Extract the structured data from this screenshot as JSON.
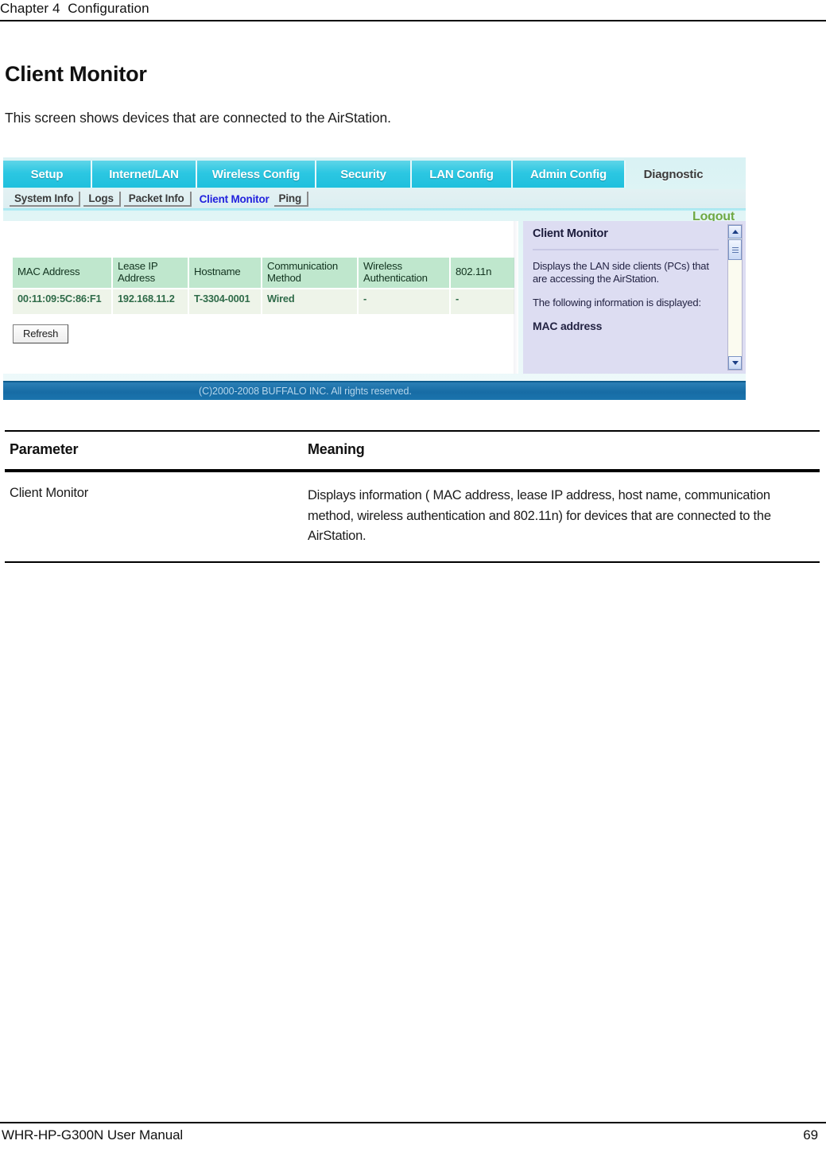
{
  "page": {
    "running_head": "Chapter 4  Configuration",
    "heading": "Client Monitor",
    "intro": "This screen shows devices that are connected to the AirStation.",
    "footer_left": "WHR-HP-G300N User Manual",
    "footer_page": "69"
  },
  "screenshot": {
    "nav_tabs": [
      {
        "label": "Setup",
        "active": false
      },
      {
        "label": "Internet/LAN",
        "active": false
      },
      {
        "label": "Wireless Config",
        "active": false
      },
      {
        "label": "Security",
        "active": false
      },
      {
        "label": "LAN Config",
        "active": false
      },
      {
        "label": "Admin Config",
        "active": false
      },
      {
        "label": "Diagnostic",
        "active": true
      }
    ],
    "sub_tabs": [
      {
        "label": "System Info",
        "active": false
      },
      {
        "label": "Logs",
        "active": false
      },
      {
        "label": "Packet Info",
        "active": false
      },
      {
        "label": "Client Monitor",
        "active": true
      },
      {
        "label": "Ping",
        "active": false
      }
    ],
    "logout_label": "Logout",
    "table": {
      "columns": [
        "MAC Address",
        "Lease IP Address",
        "Hostname",
        "Communication Method",
        "Wireless Authentication",
        "802.11n"
      ],
      "rows": [
        {
          "mac_address": "00:11:09:5C:86:F1",
          "lease_ip_address": "192.168.11.2",
          "hostname": "T-3304-0001",
          "communication_method": "Wired",
          "wireless_authentication": "-",
          "dot11n": "-"
        }
      ]
    },
    "refresh_label": "Refresh",
    "help": {
      "title": "Client Monitor",
      "paragraph1": "Displays the LAN side clients (PCs) that are accessing the AirStation.",
      "paragraph2": "The following information is displayed:",
      "item1": "MAC address"
    },
    "copyright": "(C)2000-2008 BUFFALO INC. All rights reserved."
  },
  "param_table": {
    "header": {
      "parameter": "Parameter",
      "meaning": "Meaning"
    },
    "rows": [
      {
        "parameter": "Client Monitor",
        "meaning": "Displays information ( MAC address, lease IP address, host name, communication method, wireless authentication and 802.11n) for devices that are connected to the AirStation."
      }
    ]
  },
  "colors": {
    "tab_cyan": "#2cc7e2",
    "logout_green": "#6ea843",
    "table_header_green": "#bfe7cd",
    "table_cell_text_green": "#2f6b49",
    "help_panel_lavender": "#ddddf2",
    "footer_blue": "#176ca5",
    "active_subtab_blue": "#2222dd"
  }
}
